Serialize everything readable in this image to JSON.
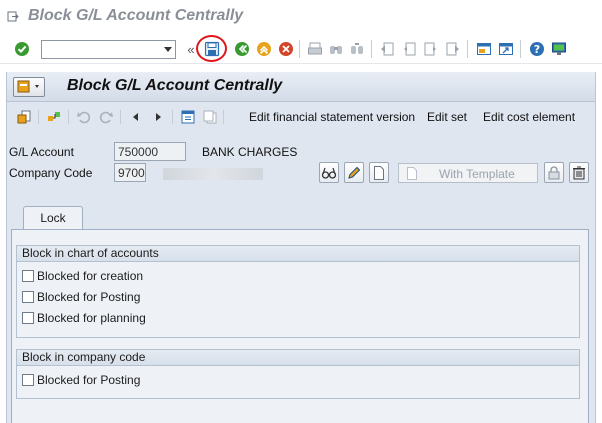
{
  "window": {
    "title": "Block G/L Account Centrally"
  },
  "toolbar": {
    "command_field_value": "",
    "icons": [
      "enter-icon",
      "save-icon",
      "back-icon",
      "exit-icon",
      "cancel-icon",
      "print-icon",
      "find-icon",
      "find-next-icon",
      "first-page-icon",
      "previous-page-icon",
      "next-page-icon",
      "last-page-icon",
      "create-session-icon",
      "shortcut-icon",
      "help-icon",
      "customize-layout-icon"
    ]
  },
  "screen": {
    "title": "Block G/L Account Centrally",
    "app_toolbar": {
      "edit_fs_version": "Edit financial statement version",
      "edit_set": "Edit set",
      "edit_cost_element": "Edit cost element"
    },
    "fields": {
      "gl_account_label": "G/L Account",
      "gl_account_value": "750000",
      "gl_account_desc": "BANK CHARGES",
      "company_code_label": "Company Code",
      "company_code_value": "9700"
    },
    "buttons": {
      "with_template": "With Template"
    },
    "tab": {
      "label": "Lock"
    },
    "group_coa": {
      "title": "Block in chart of accounts",
      "items": [
        {
          "label": "Blocked for creation",
          "checked": false
        },
        {
          "label": "Blocked for Posting",
          "checked": false
        },
        {
          "label": "Blocked for planning",
          "checked": false
        }
      ]
    },
    "group_cc": {
      "title": "Block in company code",
      "items": [
        {
          "label": "Blocked for Posting",
          "checked": false
        }
      ]
    }
  },
  "colors": {
    "enter_green": "#3a9a31",
    "cancel_red": "#d2452a",
    "highlight_red": "#e0161b",
    "screen_bg": "#dfe6ef"
  }
}
